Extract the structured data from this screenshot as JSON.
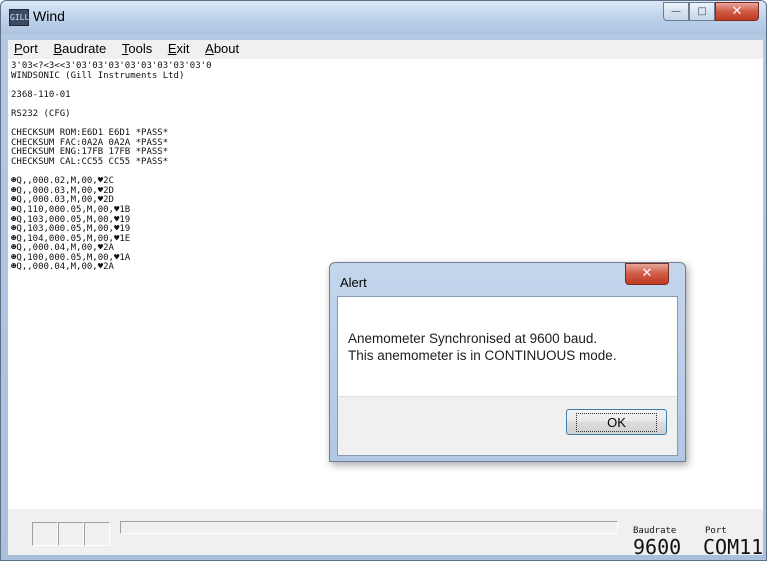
{
  "window": {
    "title": "Wind",
    "icon": "app-icon",
    "icon_glyph": "GILL",
    "caption": {
      "minimize": "—",
      "maximize": "□",
      "close": "✕"
    }
  },
  "menu": [
    "Port",
    "Baudrate",
    "Tools",
    "Exit",
    "About"
  ],
  "console_lines": [
    "3'03<?<3<<3'03'03'03'03'03'03'03'03'0",
    "WINDSONIC (Gill Instruments Ltd)",
    "",
    "2368-110-01",
    "",
    "RS232 (CFG)",
    "",
    "CHECKSUM ROM:E6D1 E6D1 *PASS*",
    "CHECKSUM FAC:0A2A 0A2A *PASS*",
    "CHECKSUM ENG:17FB 17FB *PASS*",
    "CHECKSUM CAL:CC55 CC55 *PASS*",
    "",
    "☻Q,,000.02,M,00,♥2C",
    "☻Q,,000.03,M,00,♥2D",
    "☻Q,,000.03,M,00,♥2D",
    "☻Q,110,000.05,M,00,♥1B",
    "☻Q,103,000.05,M,00,♥19",
    "☻Q,103,000.05,M,00,♥19",
    "☻Q,104,000.05,M,00,♥1E",
    "☻Q,,000.04,M,00,♥2A",
    "☻Q,100,000.05,M,00,♥1A",
    "☻Q,,000.04,M,00,♥2A"
  ],
  "status": {
    "baudrate_label": "Baudrate",
    "baudrate_value": "9600",
    "port_label": "Port",
    "port_value": "COM11"
  },
  "alert": {
    "title": "Alert",
    "close_glyph": "✕",
    "line1": "Anemometer Synchronised at 9600 baud.",
    "line2": "This anemometer is in CONTINUOUS mode.",
    "ok_label": "OK"
  }
}
